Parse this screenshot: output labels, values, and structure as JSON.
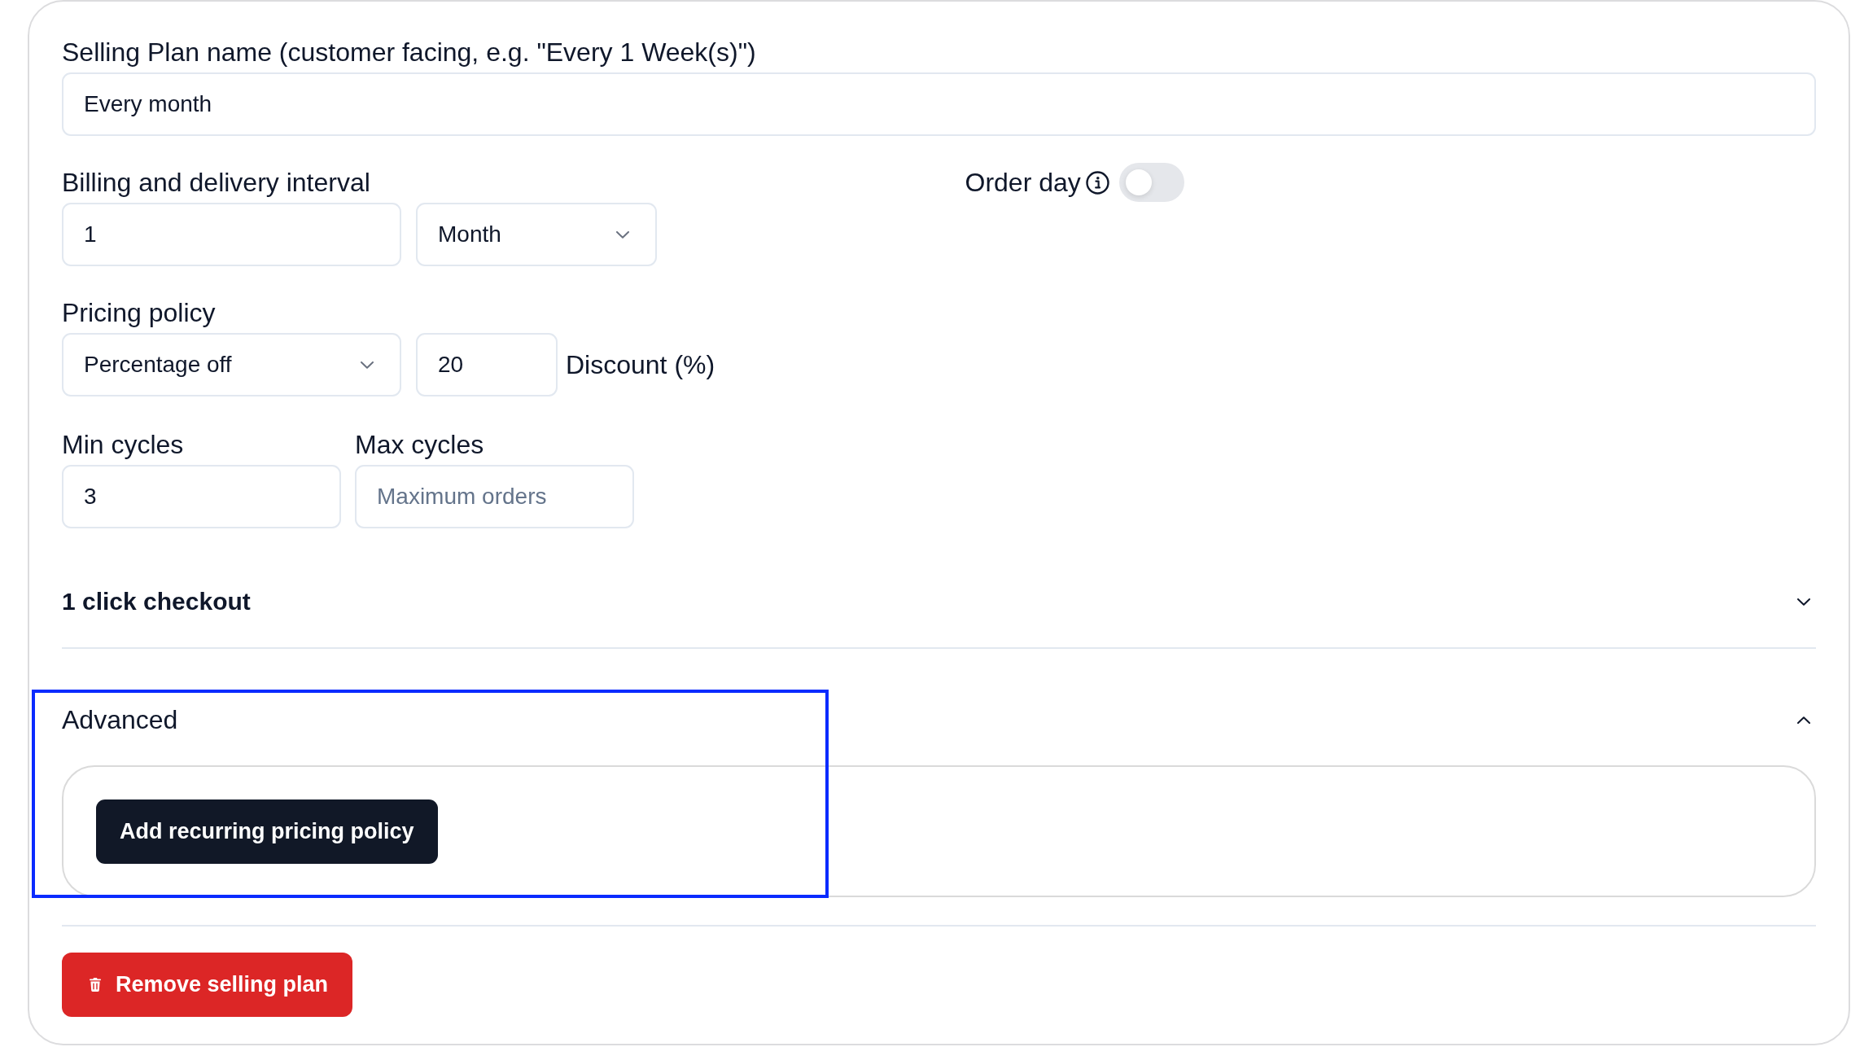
{
  "selling_plan_name": {
    "label": "Selling Plan name (customer facing, e.g. \"Every 1 Week(s)\")",
    "value": "Every month"
  },
  "interval": {
    "label": "Billing and delivery interval",
    "count": {
      "value": "1"
    },
    "unit": {
      "value": "Month"
    }
  },
  "order_day": {
    "label": "Order day",
    "on": false
  },
  "pricing_policy": {
    "label": "Pricing policy",
    "type": {
      "value": "Percentage off"
    },
    "amount": {
      "value": "20"
    },
    "amount_label": "Discount (%)"
  },
  "cycles": [
    {
      "label": "Min cycles",
      "value": "3"
    },
    {
      "label": "Max cycles",
      "placeholder": "Maximum orders"
    }
  ],
  "sections": [
    {
      "title": "1 click checkout",
      "expanded": false,
      "highlighted": false
    },
    {
      "title": "Advanced",
      "expanded": true,
      "highlighted": true,
      "buttons": [
        "Add recurring pricing policy"
      ]
    }
  ],
  "remove_button": {
    "label": "Remove selling plan"
  }
}
